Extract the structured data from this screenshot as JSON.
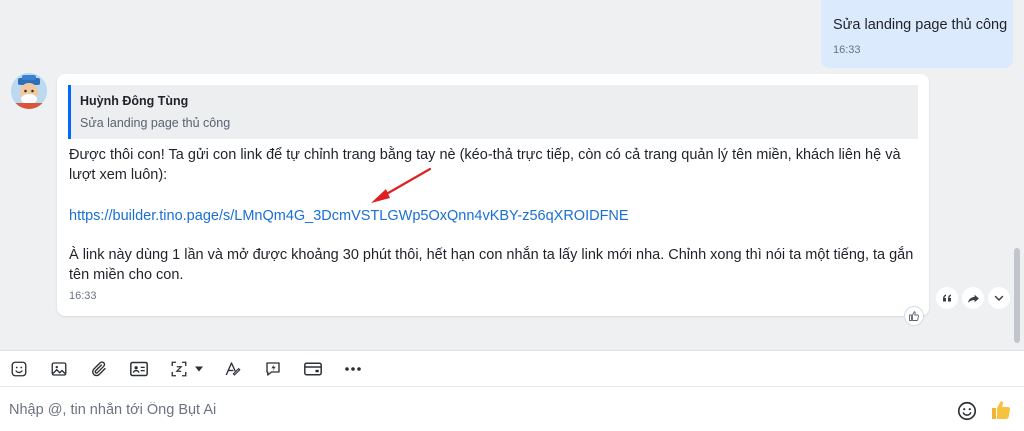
{
  "sent_message": {
    "text": "Sửa landing page thủ công",
    "time": "16:33"
  },
  "received_message": {
    "quote": {
      "author": "Huỳnh Đông Tùng",
      "text": "Sửa landing page thủ công"
    },
    "paragraph1": "Được thôi con! Ta gửi con link để tự chỉnh trang bằng tay nè (kéo-thả trực tiếp, còn có cả trang quản lý tên miền, khách liên hệ và lượt xem luôn):",
    "link": "https://builder.tino.page/s/LMnQm4G_3DcmVSTLGWp5OxQnn4vKBY-z56qXROIDFNE",
    "paragraph2": "À link này dùng 1 lần và mở được khoảng 30 phút thôi, hết hạn con nhắn ta lấy link mới nha. Chỉnh xong thì nói ta một tiếng, ta gắn tên miền cho con.",
    "time": "16:33"
  },
  "message_actions": [
    "quote-icon",
    "forward-icon",
    "more-icon"
  ],
  "toolbar_tools": [
    "sticker-icon",
    "image-icon",
    "attach-icon",
    "contact-card-icon",
    "screenshot-icon",
    "screenshot-options-icon",
    "text-format-icon",
    "quick-message-icon",
    "payment-card-icon",
    "more-icon"
  ],
  "composer": {
    "placeholder": "Nhập @, tin nhắn tới Ông Bụt Ai"
  },
  "colors": {
    "accent": "#0068ff",
    "link": "#1a6fd6",
    "sent_bubble": "#dbeafd",
    "annotation_arrow": "#e02020"
  }
}
